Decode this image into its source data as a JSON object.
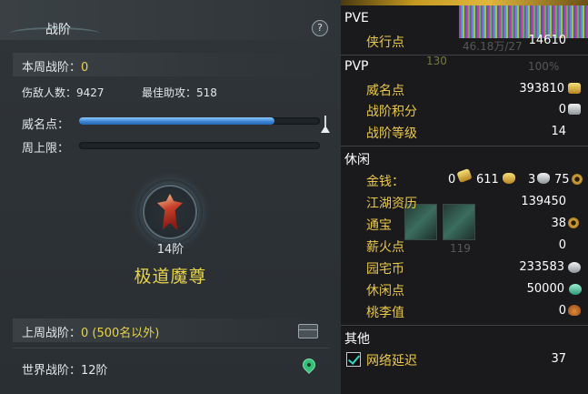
{
  "left": {
    "title": "战阶",
    "help_label": "?",
    "weekly_rank_label": "本周战阶：",
    "weekly_rank_value": "0",
    "enemies_label": "伤敌人数：",
    "enemies_value": "9427",
    "assists_label": "最佳助攻：",
    "assists_value": "518",
    "prestige_label": "威名点：",
    "prestige_progress": 0.81,
    "weekly_cap_label": "周上限：",
    "weekly_cap_progress": 0,
    "rank_level": "14阶",
    "rank_name": "极道魔尊",
    "last_week_label": "上周战阶：",
    "last_week_value": "0 (500名以外)",
    "world_label": "世界战阶：",
    "world_value": "12阶"
  },
  "right": {
    "pve": {
      "title": "PVE",
      "rows": [
        {
          "label": "侠行点",
          "value": "14610"
        }
      ],
      "ghost_text": "46.18万/27",
      "ghost_num": "130",
      "ghost_pct": "100%"
    },
    "pvp": {
      "title": "PVP",
      "rows": [
        {
          "label": "威名点",
          "value": "393810"
        },
        {
          "label": "战阶积分",
          "value": "0"
        },
        {
          "label": "战阶等级",
          "value": "14"
        }
      ]
    },
    "leisure": {
      "title": "休闲",
      "money_label": "金钱：",
      "money_gold": "0",
      "money_ingot": "611",
      "money_silver": "3",
      "money_copper": "75",
      "rows": [
        {
          "label": "江湖资历",
          "value": "139450"
        },
        {
          "label": "通宝",
          "value": "38"
        },
        {
          "label": "薪火点",
          "value": "0"
        },
        {
          "label": "园宅币",
          "value": "233583"
        },
        {
          "label": "休闲点",
          "value": "50000"
        },
        {
          "label": "桃李值",
          "value": "0"
        }
      ],
      "ghost_num": "119"
    },
    "other": {
      "title": "其他",
      "latency_label": "网络延迟",
      "latency_value": "37"
    }
  },
  "colors": {
    "accent_yellow": "#e8d44a",
    "label_gold": "#e9c84a",
    "progress_blue": "#3e86d6",
    "panel_dark": "#1a1a1c"
  }
}
